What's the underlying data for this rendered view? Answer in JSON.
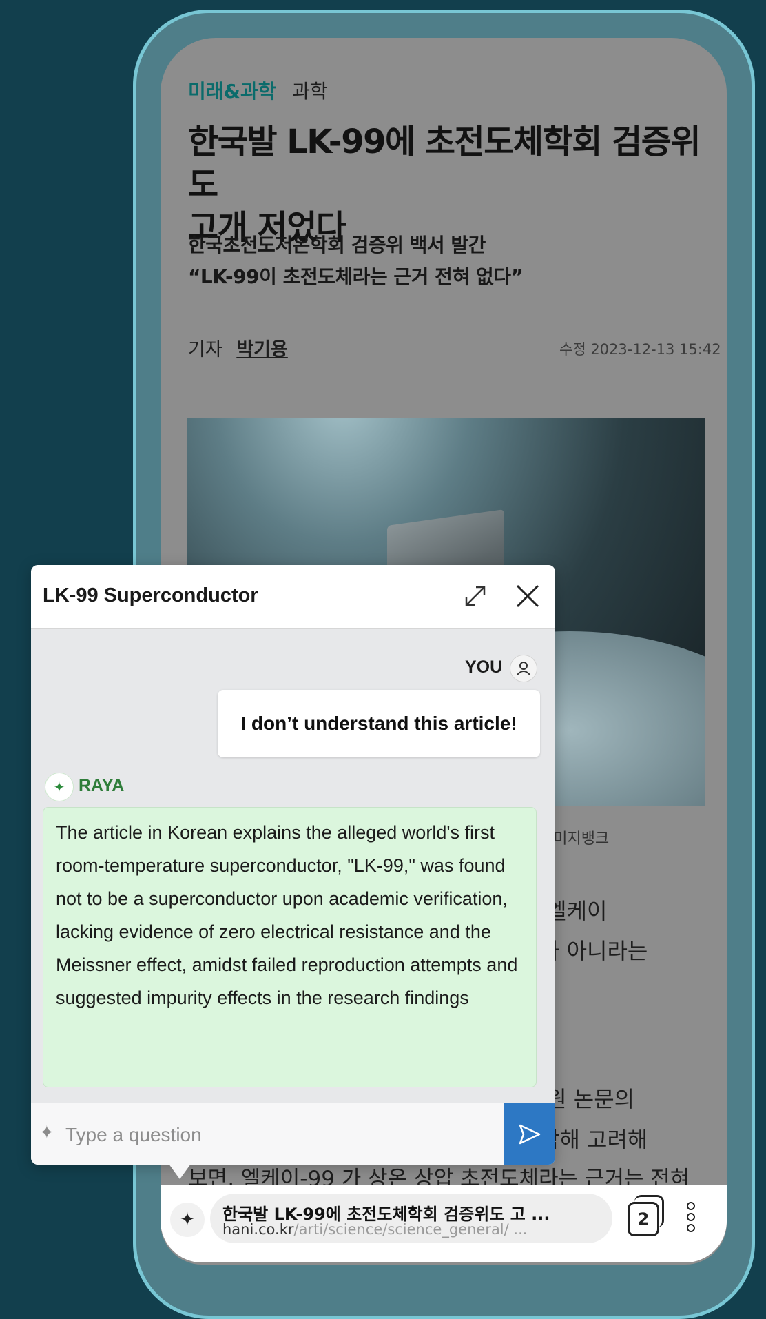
{
  "article": {
    "section_main": "미래&과학",
    "section_sub": "과학",
    "headline_line1": "한국발 LK-99에 초전도체학회 검증위도",
    "headline_line2": "고개 저었다",
    "subhead_line1": "한국초전도저온학회 검증위 백서 발간",
    "subhead_line2": "“LK-99이 초전도체라는 근거 전혀 없다”",
    "byline_label": "기자",
    "byline_name": "박기용",
    "timestamp": "수정 2023-12-13 15:42",
    "photo_caption": "이미지뱅크",
    "body_line1": "‘엘케이",
    "body_line2": "가 아니라는",
    "body_line3": "’원 논문의",
    "body_line4": "합해 고려해",
    "body_last": "보면, 엘케이-99 가 상온 상압 초전도체라는 근거는 전혀"
  },
  "chat": {
    "title": "LK-99 Superconductor",
    "user_label": "YOU",
    "user_message": "I don’t understand this article!",
    "ai_label": "RAYA",
    "ai_message": "The article in Korean explains the alleged world's first room-temperature superconductor, \"LK-99,\" was found not to be a superconductor upon academic verification, lacking evidence of zero electrical resistance and the Meissner effect, amidst failed reproduction attempts and suggested impurity effects in the research findings",
    "input_placeholder": "Type a question",
    "accent_ai": "#2f7d3a",
    "accent_send": "#2d78c4"
  },
  "address_bar": {
    "page_title": "한국발 LK-99에 초전도체학회 검증위도 고 ...",
    "url_domain": "hani.co.kr",
    "url_rest": "/arti/science/science_general/ ...",
    "tab_count": "2"
  },
  "icons": {
    "expand": "expand-icon",
    "close": "close-icon",
    "user": "user-icon",
    "sparkle": "sparkle-icon",
    "send": "send-icon",
    "tabs": "tabs-icon",
    "menu": "more-vertical-icon"
  }
}
